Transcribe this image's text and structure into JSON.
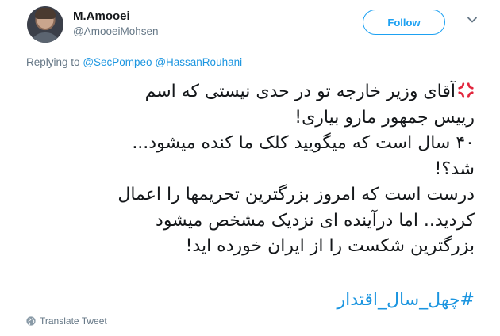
{
  "user": {
    "display_name": "M.Amooei",
    "handle": "@AmooeiMohsen"
  },
  "actions": {
    "follow_label": "Follow"
  },
  "reply": {
    "prefix": "Replying to",
    "mentions": [
      "@SecPompeo",
      "@HassanRouhani"
    ]
  },
  "tweet": {
    "lines": [
      "آقای وزیر خارجه تو در حدی نیستی که اسم",
      "رییس جمهور مارو بیاری!",
      "۴۰ سال است که میگویید کلک ما کنده میشود...",
      "شد؟!",
      "درست است که امروز بزرگترین تحریمها را اعمال",
      "کردید.. اما درآینده ای نزدیک مشخص میشود",
      "بزرگترین شکست را از ایران خورده اید!"
    ],
    "hashtag": "#چهل_سال_اقتدار"
  },
  "footer": {
    "translate_label": "Translate Tweet"
  },
  "icons": {
    "avatar": "profile-photo",
    "menu": "chevron-down-icon",
    "emoji": "anger-symbol-icon",
    "translate": "globe-icon"
  },
  "colors": {
    "accent": "#1da1f2",
    "link": "#1b95e0",
    "muted": "#657786",
    "text": "#14171a",
    "anger_emoji": "#e2263d"
  }
}
